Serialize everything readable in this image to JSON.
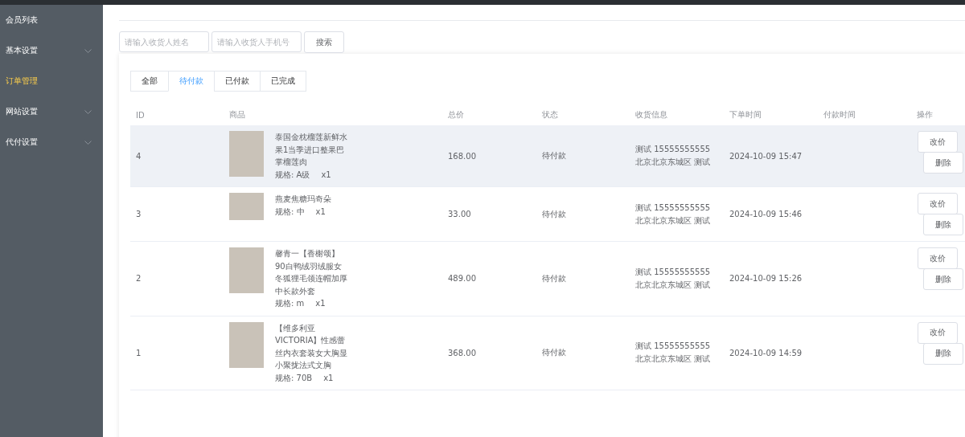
{
  "sidebar": {
    "items": [
      {
        "label": "会员列表",
        "selected": false,
        "expandable": false
      },
      {
        "label": "基本设置",
        "selected": false,
        "expandable": true
      },
      {
        "label": "订单管理",
        "selected": true,
        "expandable": false
      },
      {
        "label": "网站设置",
        "selected": false,
        "expandable": true
      },
      {
        "label": "代付设置",
        "selected": false,
        "expandable": true
      }
    ]
  },
  "search": {
    "fields": [
      {
        "placeholder": "请输入收货人姓名"
      },
      {
        "placeholder": "请输入收货人手机号"
      }
    ],
    "button": "搜索"
  },
  "tabs": [
    {
      "label": "全部",
      "selected": false
    },
    {
      "label": "待付款",
      "selected": true
    },
    {
      "label": "已付款",
      "selected": false
    },
    {
      "label": "已完成",
      "selected": false
    }
  ],
  "table": {
    "columns": [
      "ID",
      "商品",
      "总价",
      "状态",
      "收货信息",
      "下单时间",
      "付款时间",
      "操作"
    ],
    "rows": [
      {
        "id": "4",
        "hovered": true,
        "product": "泰国金枕榴莲新鲜水果1当季进口整果巴掌榴莲肉",
        "spec": "规格: A级",
        "qty": "x1",
        "total": "168.00",
        "status": "待付款",
        "address": "测试 15555555555 北京北京东城区 测试",
        "order_time": "2024-10-09 15:47",
        "actions": [
          "改价",
          "删除"
        ]
      },
      {
        "id": "3",
        "hovered": false,
        "tall": false,
        "product": "燕麦焦糖玛奇朵",
        "spec": "规格: 中",
        "qty": "x1",
        "total": "33.00",
        "status": "待付款",
        "address": "测试 15555555555 北京北京东城区 测试",
        "order_time": "2024-10-09 15:46",
        "actions": [
          "改价",
          "删除"
        ]
      },
      {
        "id": "2",
        "hovered": false,
        "product": "馨青一【香榭颂】90白鸭绒羽绒服女冬狐狸毛领连帽加厚中长款外套",
        "spec": "规格: m",
        "qty": "x1",
        "total": "489.00",
        "status": "待付款",
        "address": "测试 15555555555 北京北京东城区 测试",
        "order_time": "2024-10-09 15:26",
        "actions": [
          "改价",
          "删除"
        ]
      },
      {
        "id": "1",
        "hovered": false,
        "product": "【维多利亚 VICTORIA】性感蕾丝内衣套装女大胸显小聚拢法式文胸",
        "spec": "规格: 70B",
        "qty": "x1",
        "total": "368.00",
        "status": "待付款",
        "address": "测试 15555555555 北京北京东城区 测试",
        "order_time": "2024-10-09 14:59",
        "actions": [
          "改价",
          "删除"
        ]
      }
    ]
  }
}
